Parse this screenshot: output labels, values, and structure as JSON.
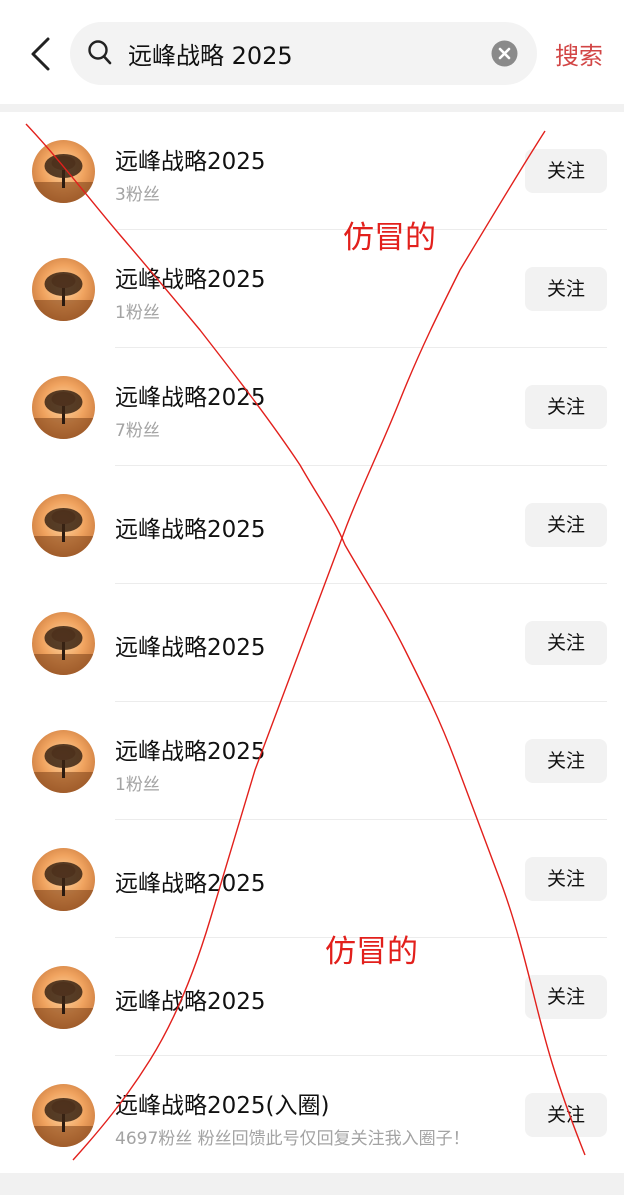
{
  "search": {
    "query": "远峰战略 2025",
    "submit_label": "搜索"
  },
  "results": [
    {
      "name": "远峰战略2025",
      "fans": "3粉丝",
      "follow_label": "关注"
    },
    {
      "name": "远峰战略2025",
      "fans": "1粉丝",
      "follow_label": "关注"
    },
    {
      "name": "远峰战略2025",
      "fans": "7粉丝",
      "follow_label": "关注"
    },
    {
      "name": "远峰战略2025",
      "fans": "",
      "follow_label": "关注"
    },
    {
      "name": "远峰战略2025",
      "fans": "",
      "follow_label": "关注"
    },
    {
      "name": "远峰战略2025",
      "fans": "1粉丝",
      "follow_label": "关注"
    },
    {
      "name": "远峰战略2025",
      "fans": "",
      "follow_label": "关注"
    },
    {
      "name": "远峰战略2025",
      "fans": "",
      "follow_label": "关注"
    },
    {
      "name": "远峰战略2025(入圈)",
      "fans": "4697粉丝 粉丝回馈此号仅回复关注我入圈子！",
      "follow_label": "关注"
    }
  ],
  "annotations": {
    "stamp_top": "仿冒的",
    "stamp_bottom": "仿冒的",
    "ink_color": "#e2201c"
  },
  "colors": {
    "accent": "#d24545",
    "follow_button_bg": "#f2f2f2"
  },
  "icons": [
    "back-icon",
    "search-icon",
    "clear-icon"
  ]
}
